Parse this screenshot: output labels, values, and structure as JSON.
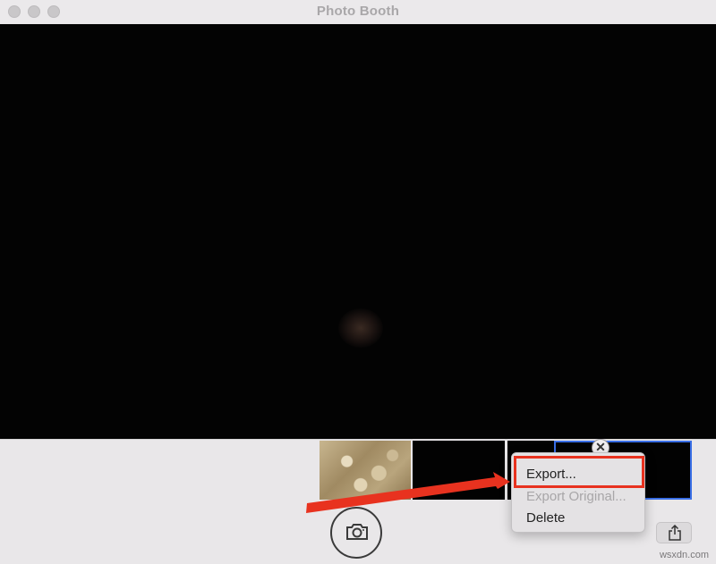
{
  "window": {
    "title": "Photo Booth"
  },
  "context_menu": {
    "items": [
      {
        "label": "Export...",
        "enabled": true
      },
      {
        "label": "Export Original...",
        "enabled": false
      },
      {
        "label": "Delete",
        "enabled": true
      }
    ]
  },
  "thumbnails": [
    {
      "name": "photo-thumbnail-1"
    },
    {
      "name": "photo-thumbnail-2"
    },
    {
      "name": "photo-thumbnail-3"
    },
    {
      "name": "photo-thumbnail-4",
      "selected": true
    }
  ],
  "icons": {
    "camera": "camera-icon",
    "share": "share-icon",
    "close": "close-icon"
  },
  "colors": {
    "highlight": "#e8321f",
    "selection": "#3a6fe6",
    "arrow": "#e8321f"
  },
  "watermark": "wsxdn.com"
}
